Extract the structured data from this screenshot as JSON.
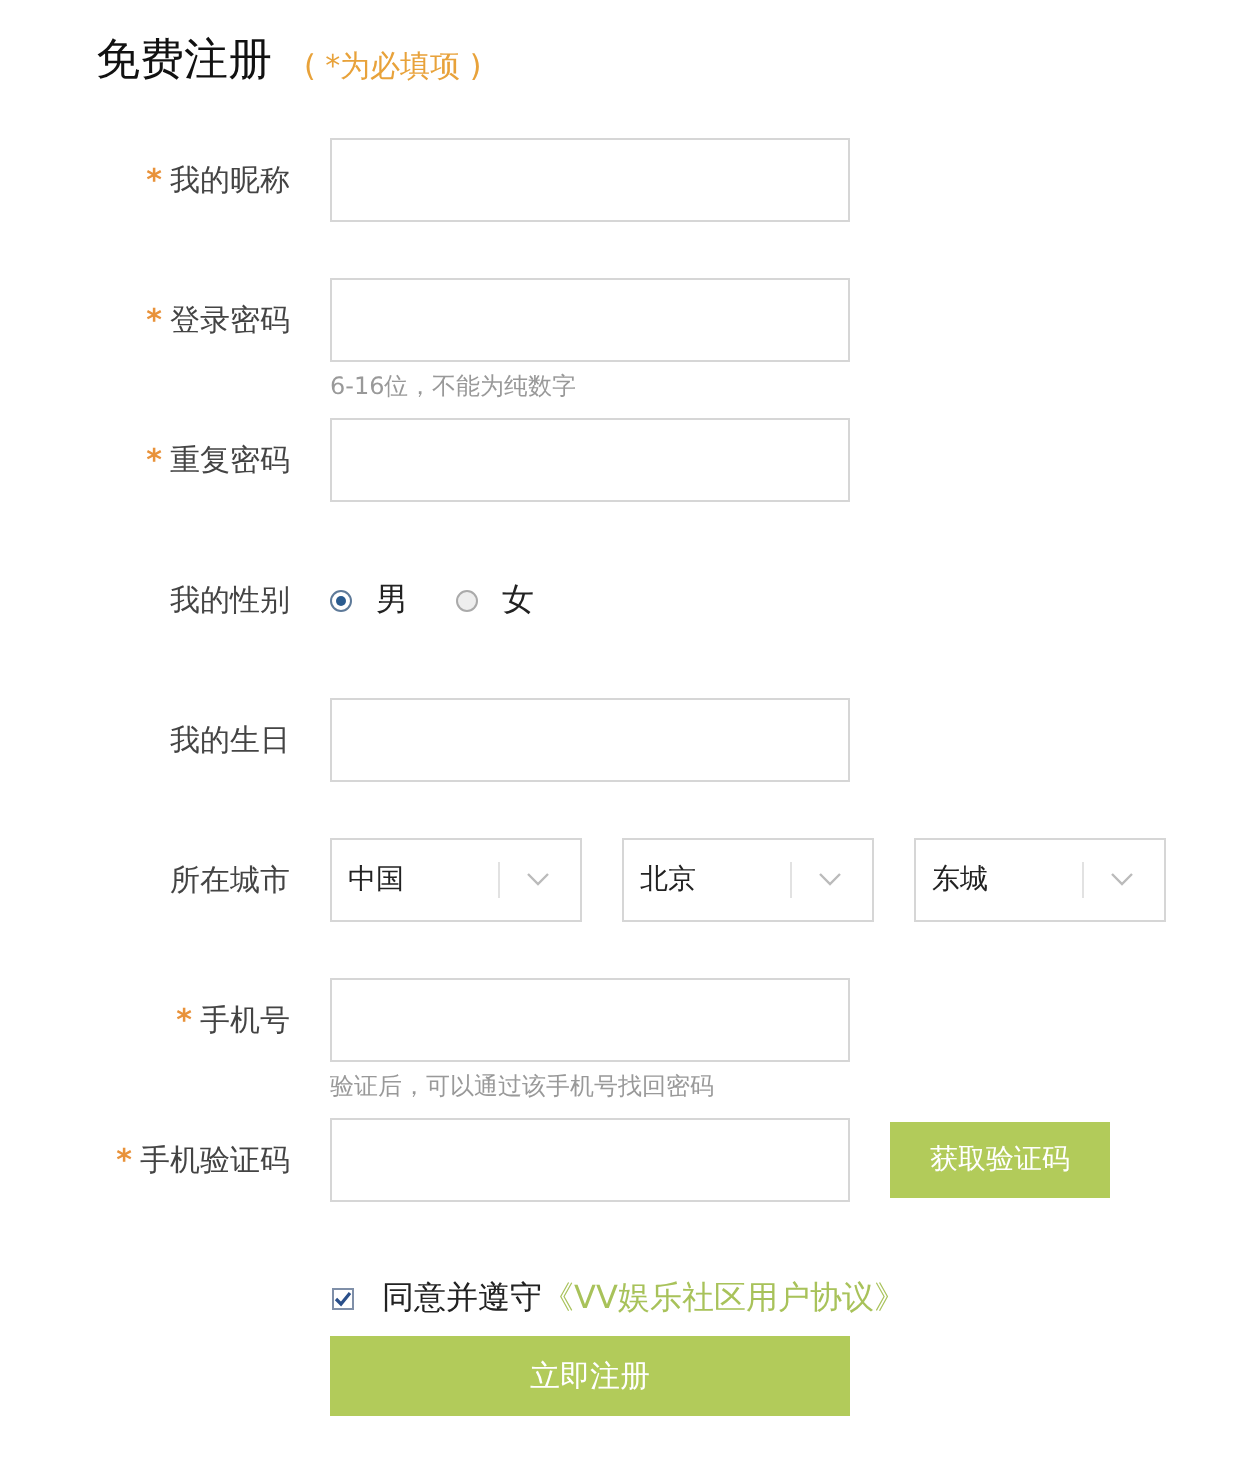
{
  "title": "免费注册",
  "required_note": "( *为必填项 )",
  "fields": [
    {
      "kind": "text",
      "label": "我的昵称",
      "required_mark": "*"
    },
    {
      "kind": "text",
      "label": "登录密码",
      "required_mark": "*",
      "hint": "6-16位，不能为纯数字"
    },
    {
      "kind": "text",
      "label": "重复密码",
      "required_mark": "*"
    },
    {
      "kind": "radio",
      "label": "我的性别",
      "options": [
        {
          "label": "男",
          "selected": true
        },
        {
          "label": "女",
          "selected": false
        }
      ]
    },
    {
      "kind": "text",
      "label": "我的生日"
    },
    {
      "kind": "select",
      "label": "所在城市",
      "selects": [
        "中国",
        "北京",
        "东城"
      ]
    },
    {
      "kind": "text",
      "label": "手机号",
      "required_mark": "*",
      "hint": "验证后，可以通过该手机号找回密码"
    },
    {
      "kind": "code",
      "label": "手机验证码",
      "required_mark": "*",
      "button": "获取验证码"
    }
  ],
  "agreement": {
    "checked": true,
    "text": "同意并遵守",
    "link": "《VV娱乐社区用户协议》"
  },
  "submit": "立即注册"
}
